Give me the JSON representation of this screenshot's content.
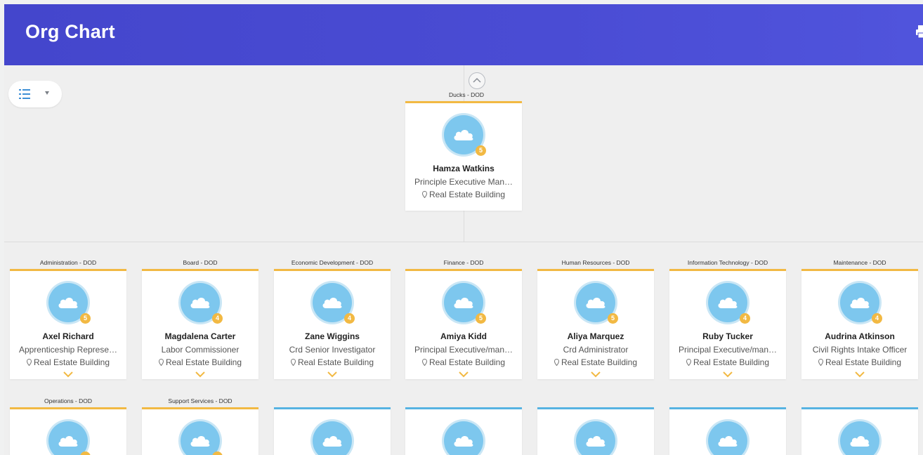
{
  "header": {
    "title": "Org Chart"
  },
  "toolbar": {
    "view_icon": "list-view-icon",
    "caret_icon": "caret-down-icon"
  },
  "colors": {
    "header": "#4a4cd4",
    "card_accent": "#f2b943",
    "card_accent_alt": "#56b3e2",
    "avatar": "#7dc7ee"
  },
  "top_node": {
    "org": "Ducks - DOD",
    "name": "Hamza Watkins",
    "role": "Principle Executive Man…",
    "location": "Real Estate Building",
    "count": "5"
  },
  "row1": [
    {
      "org": "Administration - DOD",
      "name": "Axel Richard",
      "role": "Apprenticeship Represe…",
      "location": "Real Estate Building",
      "count": "5"
    },
    {
      "org": "Board - DOD",
      "name": "Magdalena Carter",
      "role": "Labor Commissioner",
      "location": "Real Estate Building",
      "count": "4"
    },
    {
      "org": "Economic Development - DOD",
      "name": "Zane Wiggins",
      "role": "Crd Senior Investigator",
      "location": "Real Estate Building",
      "count": "4"
    },
    {
      "org": "Finance - DOD",
      "name": "Amiya Kidd",
      "role": "Principal Executive/man…",
      "location": "Real Estate Building",
      "count": "5"
    },
    {
      "org": "Human Resources - DOD",
      "name": "Aliya Marquez",
      "role": "Crd Administrator",
      "location": "Real Estate Building",
      "count": "5"
    },
    {
      "org": "Information Technology - DOD",
      "name": "Ruby Tucker",
      "role": "Principal Executive/man…",
      "location": "Real Estate Building",
      "count": "4"
    },
    {
      "org": "Maintenance - DOD",
      "name": "Audrina Atkinson",
      "role": "Civil Rights Intake Officer",
      "location": "Real Estate Building",
      "count": "4"
    }
  ],
  "row2": [
    {
      "org": "Operations - DOD",
      "accent": "yellow"
    },
    {
      "org": "Support Services - DOD",
      "accent": "yellow"
    },
    {
      "org": "",
      "accent": "blue"
    },
    {
      "org": "",
      "accent": "blue"
    },
    {
      "org": "",
      "accent": "blue"
    },
    {
      "org": "",
      "accent": "blue"
    },
    {
      "org": "",
      "accent": "blue"
    }
  ]
}
